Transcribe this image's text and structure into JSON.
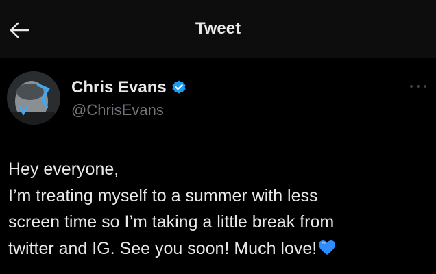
{
  "header": {
    "title": "Tweet",
    "back_icon": "arrow-left-icon"
  },
  "author": {
    "display_name": "Chris Evans",
    "handle": "@ChrisEvans",
    "verified": true,
    "verified_icon": "verified-badge-icon",
    "verified_color": "#1d9bf0"
  },
  "more_icon": "more-options-icon",
  "tweet": {
    "lines": [
      "Hey everyone,",
      "I’m treating myself to a summer with less",
      "screen time so I’m taking a little break from",
      "twitter and IG. See you soon! Much love!"
    ],
    "trailing_emoji": "blue-heart-icon"
  },
  "colors": {
    "background": "#000000",
    "header_background": "#0d0d0d",
    "primary_text": "#e7e9ea",
    "secondary_text": "#71767b",
    "accent": "#1d9bf0",
    "heart": "#2f8cff"
  }
}
